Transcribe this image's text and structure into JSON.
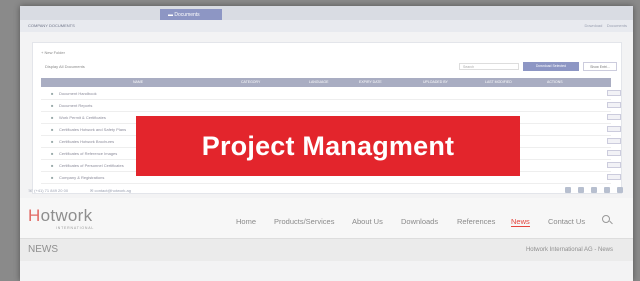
{
  "header": {
    "tab_label": "Documents",
    "section_title": "COMPANY DOCUMENTS",
    "right_links": [
      "Download",
      "Documents"
    ]
  },
  "toolbar": {
    "new_folder": "New Folder",
    "display_label": "Display All Documents",
    "search_placeholder": "Search",
    "download_button": "Download Selected",
    "show_button": "Show Entri..."
  },
  "table": {
    "columns": [
      "NAME",
      "CATEGORY",
      "LANGUAGE",
      "EXPIRY DATE",
      "UPLOADED BY",
      "LAST MODIFIED",
      "ACTIONS"
    ],
    "rows": [
      "Document Handbook",
      "Document Reports",
      "Work Permit & Certificates",
      "Certificates Hotwork and Safety Plans",
      "Certificates Hotwork Brochures",
      "Certificates of Reference Images",
      "Certificates of Personnel Certificates",
      "Company & Registrations"
    ]
  },
  "contact": {
    "phone": "(+41) 71 849 20 00",
    "email": "contact@hotwork.ag"
  },
  "nav": {
    "logo_text": "Hotwork",
    "logo_sub": "INTERNATIONAL",
    "items": [
      "Home",
      "Products/Services",
      "About Us",
      "Downloads",
      "References",
      "News",
      "Contact Us"
    ],
    "active": "News"
  },
  "page": {
    "title": "NEWS",
    "breadcrumb": "Hotwork International AG - News"
  },
  "banner": {
    "text": "Project Managment",
    "color": "#e3252c"
  }
}
